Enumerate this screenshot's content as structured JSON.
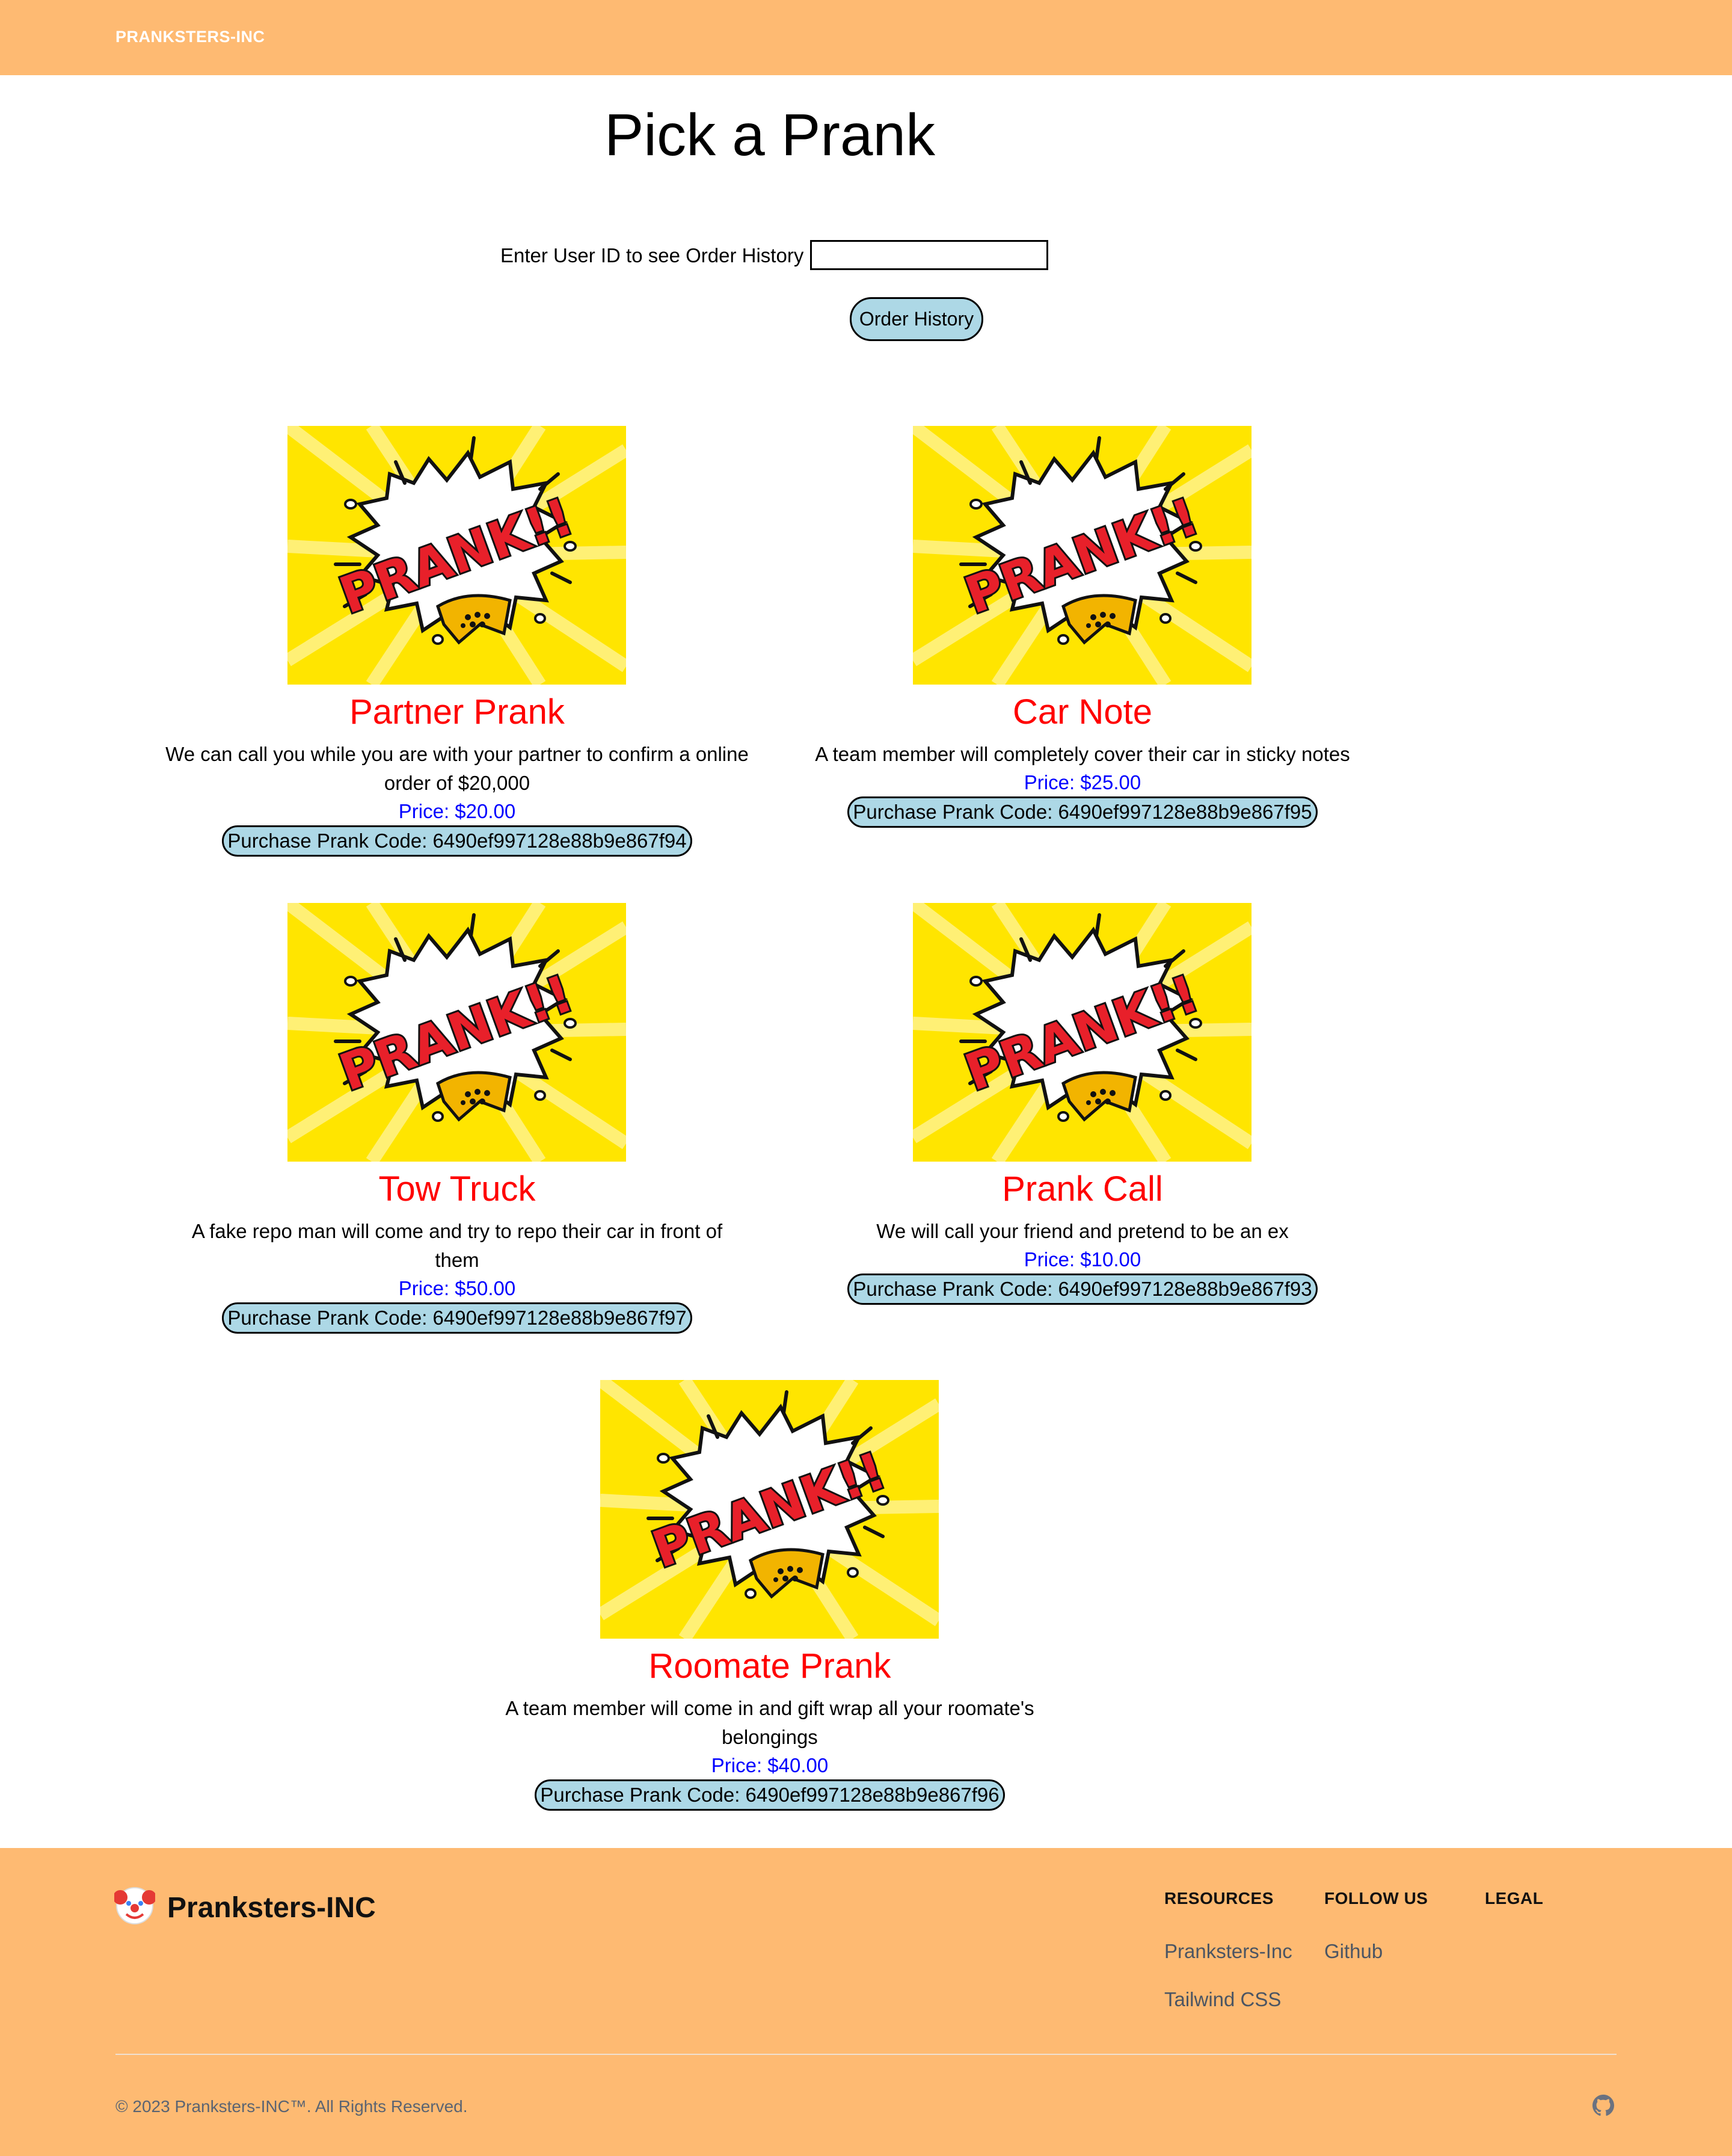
{
  "header": {
    "brand": "PRANKSTERS-INC"
  },
  "page": {
    "title": "Pick a Prank"
  },
  "order_lookup": {
    "label": "Enter User ID to see Order History",
    "input_value": "",
    "button_label": "Order History"
  },
  "pranks": [
    {
      "name": "Partner Prank",
      "description_line1": "We can call you while you are with your partner to confirm a online",
      "description_line2": "order of $20,000",
      "price": "Price: $20.00",
      "button": "Purchase Prank Code: 6490ef997128e88b9e867f94"
    },
    {
      "name": "Car Note",
      "description_line1": "A team member will completely cover their car in sticky notes",
      "description_line2": "",
      "price": "Price: $25.00",
      "button": "Purchase Prank Code: 6490ef997128e88b9e867f95"
    },
    {
      "name": "Tow Truck",
      "description_line1": "A fake repo man will come and try to repo their car in front of",
      "description_line2": "them",
      "price": "Price: $50.00",
      "button": "Purchase Prank Code: 6490ef997128e88b9e867f97"
    },
    {
      "name": "Prank Call",
      "description_line1": "We will call your friend and pretend to be an ex",
      "description_line2": "",
      "price": "Price: $10.00",
      "button": "Purchase Prank Code: 6490ef997128e88b9e867f93"
    },
    {
      "name": "Roomate Prank",
      "description_line1": "A team member will come in and gift wrap all your roomate's",
      "description_line2": "belongings",
      "price": "Price: $40.00",
      "button": "Purchase Prank Code: 6490ef997128e88b9e867f96"
    }
  ],
  "prank_image_text": "PRANK!!",
  "footer": {
    "brand": "Pranksters-INC",
    "logo_icon": "clown-face-icon",
    "columns": [
      {
        "title": "RESOURCES",
        "links": [
          "Pranksters-Inc",
          "Tailwind CSS"
        ]
      },
      {
        "title": "FOLLOW US",
        "links": [
          "Github"
        ]
      },
      {
        "title": "LEGAL",
        "links": []
      }
    ],
    "copyright": "© 2023 Pranksters-INC™. All Rights Reserved.",
    "social_icon": "github-icon"
  },
  "colors": {
    "header_bg": "#FEBA72",
    "prank_name": "#FF0000",
    "price": "#0000FF",
    "button_bg": "#ADD8E6",
    "image_bg": "#FFE500"
  }
}
